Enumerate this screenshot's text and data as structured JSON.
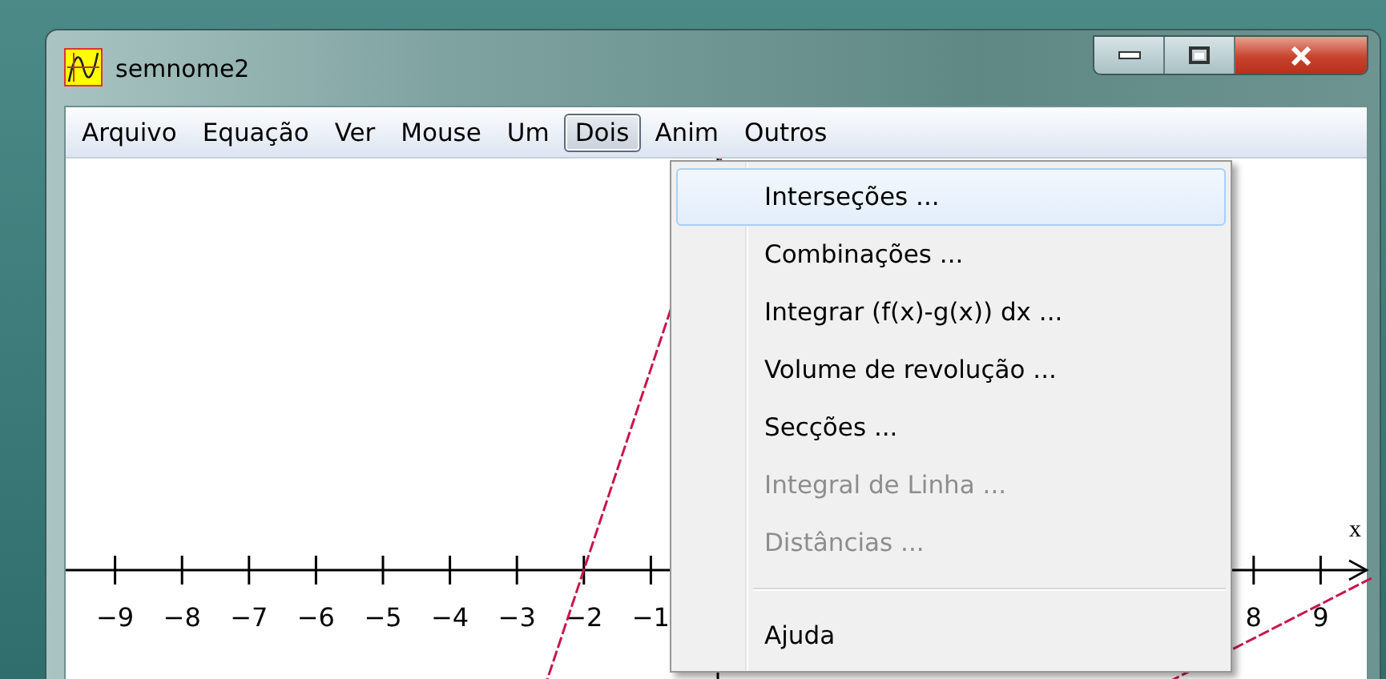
{
  "window": {
    "title": "semnome2"
  },
  "menu_bar": [
    {
      "label": "Arquivo",
      "selected": false
    },
    {
      "label": "Equação",
      "selected": false
    },
    {
      "label": "Ver",
      "selected": false
    },
    {
      "label": "Mouse",
      "selected": false
    },
    {
      "label": "Um",
      "selected": false
    },
    {
      "label": "Dois",
      "selected": true
    },
    {
      "label": "Anim",
      "selected": false
    },
    {
      "label": "Outros",
      "selected": false
    }
  ],
  "dropdown": [
    {
      "kind": "command",
      "label": "Interseções ...",
      "selected": true,
      "disabled": false
    },
    {
      "kind": "command",
      "label": "Combinações ...",
      "selected": false,
      "disabled": false
    },
    {
      "kind": "command",
      "label": "Integrar (f(x)-g(x)) dx ...",
      "selected": false,
      "disabled": false
    },
    {
      "kind": "command",
      "label": "Volume de revolução ...",
      "selected": false,
      "disabled": false
    },
    {
      "kind": "command",
      "label": "Secções ...",
      "selected": false,
      "disabled": false
    },
    {
      "kind": "command",
      "label": "Integral de Linha ...",
      "selected": false,
      "disabled": true
    },
    {
      "kind": "command",
      "label": "Distâncias ...",
      "selected": false,
      "disabled": true
    },
    {
      "kind": "separator"
    },
    {
      "kind": "command",
      "label": "Ajuda",
      "selected": false,
      "disabled": false
    }
  ],
  "graph": {
    "axis_label": "x",
    "negative_ticks": [
      "−9",
      "−8",
      "−7",
      "−6",
      "−5",
      "−4",
      "−3",
      "−2",
      "−1"
    ],
    "positive_ticks": [
      "8",
      "9"
    ]
  }
}
